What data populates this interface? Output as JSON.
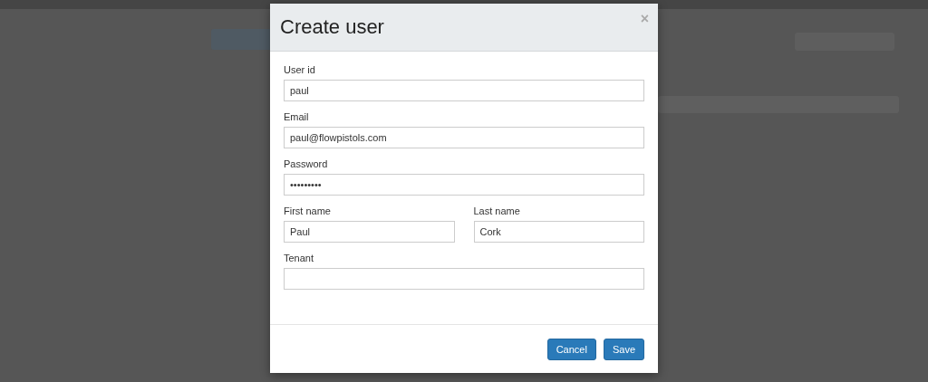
{
  "dialog": {
    "title": "Create user",
    "close": "×",
    "fields": [
      {
        "kind": "text",
        "label": "User id",
        "value": "paul"
      },
      {
        "kind": "text",
        "label": "Email",
        "value": "paul@flowpistols.com"
      },
      {
        "kind": "text",
        "label": "Password",
        "value": "•••••••••"
      }
    ],
    "name_fields": [
      {
        "label": "First name",
        "value": "Paul"
      },
      {
        "label": "Last name",
        "value": "Cork"
      }
    ],
    "tenant": {
      "label": "Tenant"
    },
    "buttons": [
      {
        "label": "Cancel"
      },
      {
        "label": "Save"
      }
    ]
  }
}
